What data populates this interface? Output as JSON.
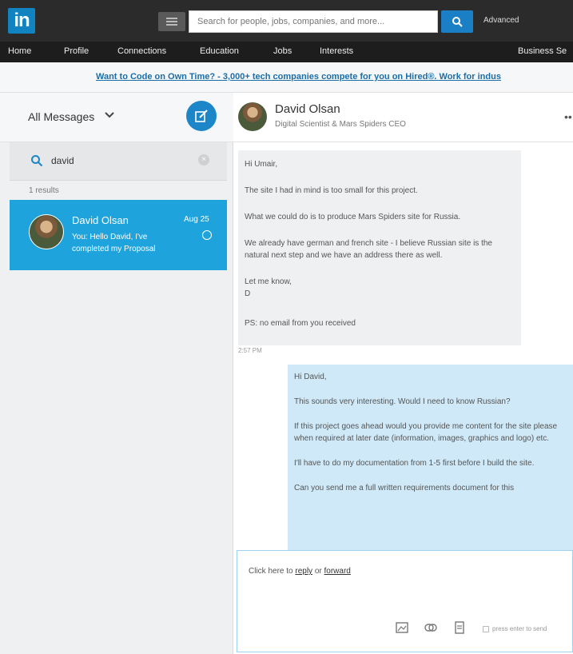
{
  "header": {
    "logo": "in",
    "search_placeholder": "Search for people, jobs, companies, and more...",
    "advanced_label": "Advanced"
  },
  "nav": {
    "items": [
      "Home",
      "Profile",
      "Connections",
      "Education",
      "Jobs",
      "Interests",
      "Business Se"
    ]
  },
  "ad": {
    "text": "Want to Code on Own Time? - 3,000+ tech companies compete for you on Hired®. Work for indus"
  },
  "inbox": {
    "filter_label": "All Messages",
    "search_value": "david",
    "results_text": "1 results",
    "conversations": [
      {
        "name": "David Olsan",
        "preview": "You: Hello David, I've completed my Proposal",
        "date": "Aug 25"
      }
    ]
  },
  "thread": {
    "contact_name": "David Olsan",
    "contact_title": "Digital Scientist & Mars Spiders CEO",
    "incoming": {
      "lines": [
        "Hi Umair,",
        "The site I had in mind is too small for this project.",
        "What we could do is to produce Mars Spiders site for Russia.",
        "We already have german and french site - I believe Russian site is the natural next step and we have an address there as well.",
        "Let me know,",
        "D",
        "PS: no email from you received"
      ],
      "time": "2:57 PM"
    },
    "outgoing": {
      "lines": [
        "Hi David,",
        "This sounds very interesting. Would I need to know Russian?",
        "If this project goes ahead would you provide me content for the site please when required at later date (information, images, graphics and logo) etc.",
        "I'll have to do my documentation from 1-5 first before I build the site.",
        "Can you send me a full written requirements document for this"
      ]
    }
  },
  "reply": {
    "prefix": "Click here to",
    "reply_link": "reply",
    "or_text": "or",
    "forward_link": "forward",
    "enter_label": "press enter to send"
  },
  "colors": {
    "brand": "#1283c1",
    "selected_conversation": "#1fa3dd",
    "outgoing_bubble": "#cfe9f8",
    "incoming_bubble": "#eef0f2"
  },
  "icons": [
    "menu-icon",
    "search-icon",
    "chevron-down-icon",
    "compose-icon",
    "clear-icon",
    "status-icon",
    "more-icon",
    "image-icon",
    "attach-icon",
    "document-icon"
  ]
}
